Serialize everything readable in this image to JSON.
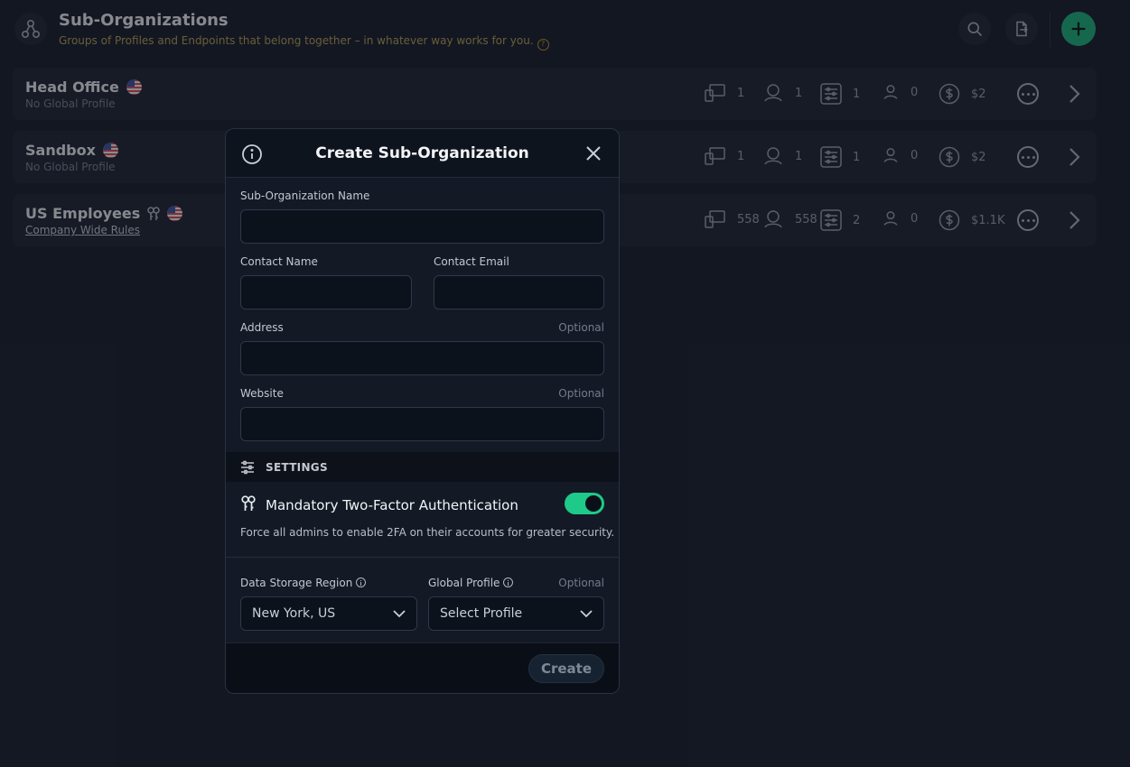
{
  "header": {
    "title": "Sub-Organizations",
    "subtitle": "Groups of Profiles and Endpoints that belong together – in whatever way works for you."
  },
  "organizations": [
    {
      "name": "Head Office",
      "profile": "No Global Profile",
      "devices": "1",
      "users_devices": "1",
      "policies": "1",
      "admins": "0",
      "cost": "$2"
    },
    {
      "name": "Sandbox",
      "profile": "No Global Profile",
      "devices": "1",
      "users_devices": "1",
      "policies": "1",
      "admins": "0",
      "cost": "$2"
    },
    {
      "name": "US Employees",
      "profile": "Company Wide Rules",
      "devices": "558",
      "users_devices": "558",
      "policies": "2",
      "admins": "0",
      "cost": "$1.1K"
    }
  ],
  "modal": {
    "title": "Create Sub-Organization",
    "fields": {
      "name_label": "Sub-Organization Name",
      "contact_name_label": "Contact Name",
      "contact_email_label": "Contact Email",
      "address_label": "Address",
      "address_optional": "Optional",
      "website_label": "Website",
      "website_optional": "Optional"
    },
    "settings_label": "SETTINGS",
    "twofa": {
      "title": "Mandatory Two-Factor Authentication",
      "description": "Force all admins to enable 2FA on their accounts for greater security.",
      "enabled": true
    },
    "region": {
      "label": "Data Storage Region",
      "value": "New York, US"
    },
    "profile": {
      "label": "Global Profile",
      "optional": "Optional",
      "value": "Select Profile"
    },
    "create_label": "Create"
  },
  "colors": {
    "accent": "#1fc98a",
    "background": "#1c2230",
    "modal": "#131a26"
  }
}
